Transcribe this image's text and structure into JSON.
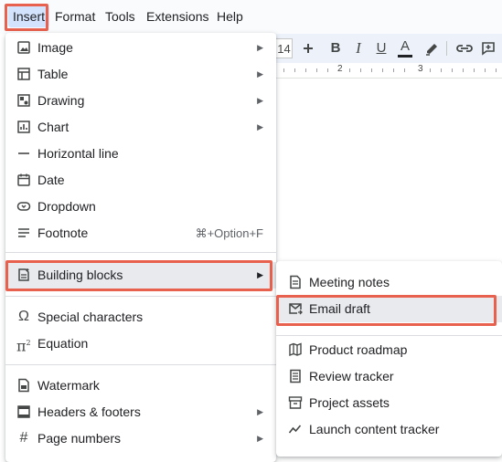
{
  "menubar": {
    "items": [
      "Insert",
      "Format",
      "Tools",
      "Extensions",
      "Help"
    ],
    "active": "Insert"
  },
  "toolbar": {
    "font_size": "14",
    "increase_icon": "plus-icon",
    "buttons": [
      "B",
      "I",
      "U",
      "A"
    ],
    "icons": [
      "bold-icon",
      "italic-icon",
      "underline-icon",
      "text-color-icon",
      "highlighter-icon",
      "link-icon",
      "comment-icon"
    ]
  },
  "ruler": {
    "labels": [
      "2",
      "3"
    ]
  },
  "insert_menu": {
    "items": [
      {
        "label": "Image",
        "icon": "image-icon",
        "submenu": true
      },
      {
        "label": "Table",
        "icon": "table-icon",
        "submenu": true
      },
      {
        "label": "Drawing",
        "icon": "drawing-icon",
        "submenu": true
      },
      {
        "label": "Chart",
        "icon": "chart-icon",
        "submenu": true
      },
      {
        "label": "Horizontal line",
        "icon": "horizontal-line-icon"
      },
      {
        "label": "Date",
        "icon": "calendar-icon"
      },
      {
        "label": "Dropdown",
        "icon": "dropdown-icon"
      },
      {
        "label": "Footnote",
        "icon": "footnote-icon",
        "shortcut": "⌘+Option+F"
      },
      {
        "label": "Building blocks",
        "icon": "building-blocks-icon",
        "submenu": true,
        "highlighted": true
      },
      {
        "label": "Special characters",
        "icon": "omega-icon"
      },
      {
        "label": "Equation",
        "icon": "pi-icon"
      },
      {
        "label": "Watermark",
        "icon": "watermark-icon"
      },
      {
        "label": "Headers & footers",
        "icon": "headers-footers-icon",
        "submenu": true
      },
      {
        "label": "Page numbers",
        "icon": "hash-icon",
        "submenu": true
      }
    ]
  },
  "building_blocks_menu": {
    "items": [
      {
        "label": "Meeting notes",
        "icon": "meeting-notes-icon"
      },
      {
        "label": "Email draft",
        "icon": "email-draft-icon",
        "highlighted": true
      },
      {
        "label": "Product roadmap",
        "icon": "roadmap-icon"
      },
      {
        "label": "Review tracker",
        "icon": "review-tracker-icon"
      },
      {
        "label": "Project assets",
        "icon": "project-assets-icon"
      },
      {
        "label": "Launch content tracker",
        "icon": "launch-tracker-icon"
      }
    ]
  },
  "colors": {
    "highlight_border": "#e8614f",
    "active_menu_bg": "#d3e3fd",
    "hover_bg": "#e8eaed"
  }
}
